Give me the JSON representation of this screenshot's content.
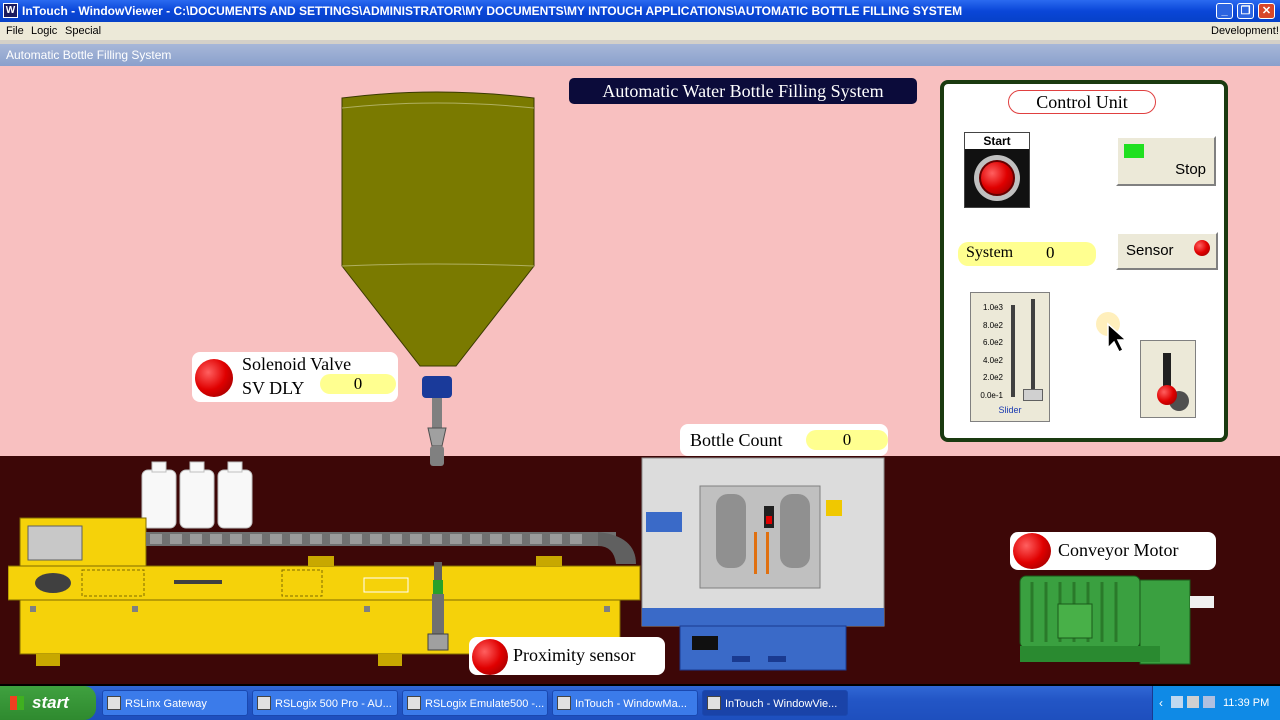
{
  "window": {
    "app_name": "InTouch - WindowViewer - C:\\DOCUMENTS AND SETTINGS\\ADMINISTRATOR\\MY DOCUMENTS\\MY INTOUCH APPLICATIONS\\AUTOMATIC BOTTLE FILLING SYSTEM",
    "min_symbol": "_",
    "max_symbol": "❐",
    "close_symbol": "✕"
  },
  "menu": {
    "items": [
      "File",
      "Logic",
      "Special"
    ],
    "right_label": "Development!"
  },
  "inner_window_title": "Automatic Bottle Filling System",
  "scene": {
    "heading": "Automatic Water Bottle Filling System",
    "solenoid": {
      "label": "Solenoid Valve",
      "delay_label": "SV DLY",
      "delay_value": "0"
    },
    "bottle_count": {
      "label": "Bottle Count",
      "value": "0"
    },
    "proximity": {
      "label": "Proximity sensor"
    },
    "conveyor": {
      "label": "Conveyor Motor"
    }
  },
  "control_unit": {
    "title": "Control Unit",
    "start_label": "Start",
    "stop_label": "Stop",
    "system_label": "System",
    "system_value": "0",
    "sensor_label": "Sensor",
    "slider_label": "Slider",
    "slider_ticks": [
      "1.0e3",
      "8.0e2",
      "6.0e2",
      "4.0e2",
      "2.0e2",
      "0.0e-1"
    ],
    "slider_value_fraction": 0.0
  },
  "taskbar": {
    "start_label": "start",
    "tasks": [
      {
        "label": "RSLinx Gateway",
        "active": false
      },
      {
        "label": "RSLogix 500 Pro - AU...",
        "active": false
      },
      {
        "label": "RSLogix Emulate500 -...",
        "active": false
      },
      {
        "label": "InTouch - WindowMa...",
        "active": false
      },
      {
        "label": "InTouch - WindowVie...",
        "active": true
      }
    ],
    "clock": "11:39 PM"
  },
  "colors": {
    "background_pink": "#f8c0c0",
    "floor": "#3d0707",
    "tank": "#7a7a00",
    "conveyor_yellow": "#f5d20a",
    "motor_green": "#3aa040"
  }
}
